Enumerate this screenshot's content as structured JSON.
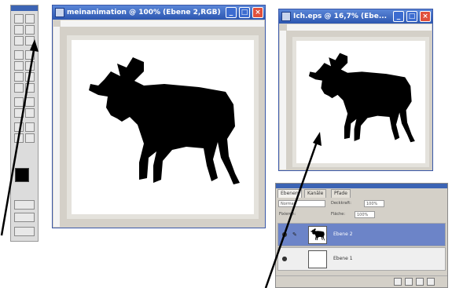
{
  "toolbox": {
    "tools": [
      "marquee",
      "move",
      "lasso",
      "magic-wand",
      "crop",
      "slice",
      "healing",
      "brush",
      "stamp",
      "history-brush",
      "eraser",
      "gradient",
      "blur",
      "dodge",
      "path-select",
      "type",
      "pen",
      "shape",
      "notes",
      "eyedropper",
      "hand",
      "zoom"
    ],
    "foreground_color": "#000000",
    "background_color": "#ffffff"
  },
  "main_window": {
    "title": "meinanimation @ 100% (Ebene 2,RGB)",
    "buttons": {
      "minimize": "_",
      "maximize": "□",
      "close": "×"
    }
  },
  "preview_window": {
    "title": "Ich.eps @ 16,7% (Ebe...",
    "buttons": {
      "minimize": "_",
      "maximize": "□",
      "close": "×"
    }
  },
  "layers_panel": {
    "tabs": [
      "Ebenen",
      "Kanäle",
      "Pfade"
    ],
    "blend_mode": "Normal",
    "opacity_label": "Deckkraft:",
    "opacity_value": "100%",
    "lock_label": "Fixieren:",
    "fill_label": "Fläche:",
    "fill_value": "100%",
    "layers": [
      {
        "name": "Ebene 2",
        "selected": true,
        "visible": true
      },
      {
        "name": "Ebene 1",
        "selected": false,
        "visible": true
      }
    ],
    "eye_glyph": "●"
  },
  "colors": {
    "title_bar": "#2c56b0",
    "selected_layer": "#6c84c8",
    "window_chrome": "#d4d0c8"
  }
}
